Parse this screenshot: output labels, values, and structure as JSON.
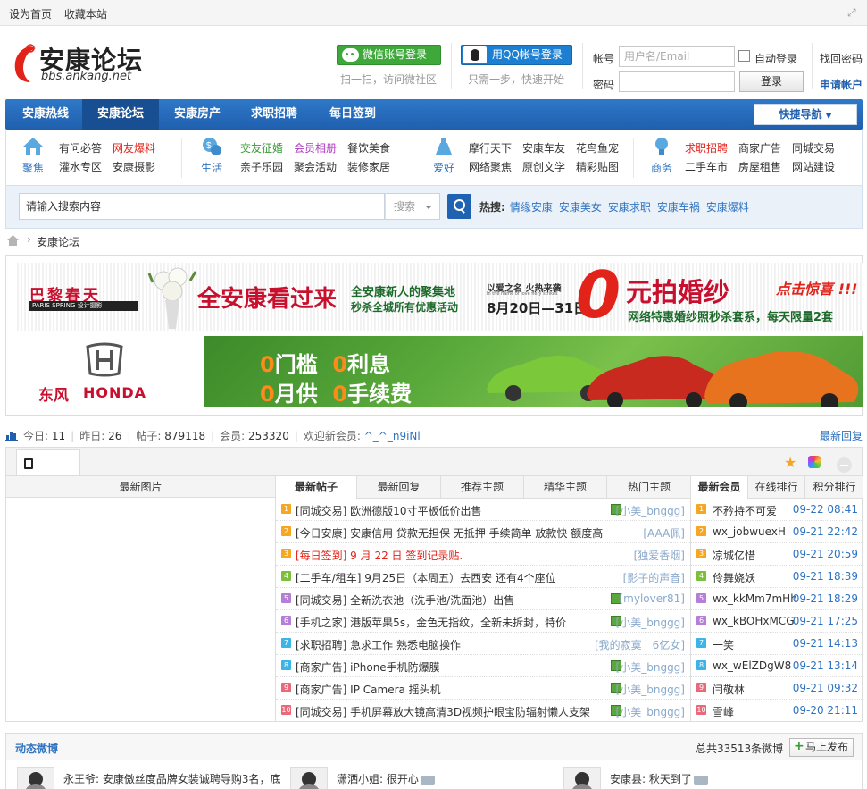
{
  "topbar": {
    "set_home": "设为首页",
    "bookmark": "收藏本站"
  },
  "logo": {
    "cn": "安康论坛",
    "url": "bbs.ankang.net"
  },
  "social": {
    "wechat_login": "微信账号登录",
    "wechat_sub": "扫一扫，访问微社区",
    "qq_login": "用QQ帐号登录",
    "qq_sub": "只需一步，快速开始"
  },
  "login": {
    "account_label": "帐号",
    "account_placeholder": "用户名/Email",
    "password_label": "密码",
    "auto_login": "自动登录",
    "login_button": "登录",
    "forgot": "找回密码",
    "register": "申请帐户"
  },
  "nav": {
    "items": [
      "安康热线",
      "安康论坛",
      "安康房产",
      "求职招聘",
      "每日签到"
    ],
    "quick": "快捷导航"
  },
  "categories": [
    {
      "name": "聚焦",
      "links": [
        "有问必答",
        "网友爆料",
        "灌水专区",
        "安康摄影"
      ]
    },
    {
      "name": "生活",
      "links": [
        "交友征婚",
        "会员相册",
        "餐饮美食",
        "亲子乐园",
        "聚会活动",
        "装修家居"
      ]
    },
    {
      "name": "爱好",
      "links": [
        "摩行天下",
        "安康车友",
        "花鸟鱼宠",
        "网络聚焦",
        "原创文学",
        "精彩贴图"
      ]
    },
    {
      "name": "商务",
      "links": [
        "求职招聘",
        "商家广告",
        "同城交易",
        "二手车市",
        "房屋租售",
        "网站建设"
      ]
    }
  ],
  "search": {
    "placeholder": "请输入搜索内容",
    "type": "搜索",
    "hot_label": "热搜:",
    "hot": [
      "情缘安康",
      "安康美女",
      "安康求职",
      "安康车祸",
      "安康爆料"
    ]
  },
  "breadcrumb": {
    "current": "安康论坛"
  },
  "banner1": {
    "brand_cn": "巴黎春天",
    "brand_en": "PARIS SPRING",
    "brand_tag": "设计摄影",
    "headline": "全安康看过来",
    "sub1": "全安康新人的聚集地",
    "sub2": "秒杀全城所有优惠活动",
    "sub3": "以爱之名 火热来袭",
    "sub4": "In the name of love fiery strikes",
    "date": "8月20日—31日",
    "zero": "0",
    "zero_text": "元拍婚纱",
    "promo": "点击惊喜 !!!",
    "detail": "网络特惠婚纱照秒杀套系，每天限量2套"
  },
  "banner2": {
    "brand_cn": "东风",
    "brand_en": "HONDA",
    "l1a": "0",
    "l1b": "门槛",
    "l1c": "0",
    "l1d": "利息",
    "l2a": "0",
    "l2b": "月供",
    "l2c": "0",
    "l2d": "手续费"
  },
  "stats": {
    "today_label": "今日:",
    "today": "11",
    "yesterday_label": "昨日:",
    "yesterday": "26",
    "posts_label": "帖子:",
    "posts": "879118",
    "members_label": "会员:",
    "members": "253320",
    "welcome": "欢迎新会员:",
    "newest": "^_^_n9iNl",
    "latest_reply": "最新回复"
  },
  "left_col": {
    "title": "最新图片"
  },
  "mid_tabs": [
    "最新帖子",
    "最新回复",
    "推荐主题",
    "精华主题",
    "热门主题"
  ],
  "threads": [
    {
      "n": "1",
      "title": "[同城交易] 欧洲德版10寸平板低价出售",
      "author": "[小美_bnggg]",
      "img": true,
      "red": false
    },
    {
      "n": "2",
      "title": "[今日安康] 安康信用 贷款无担保 无抵押 手续简单 放款快 额度高",
      "author": "[AAA佩]",
      "img": false,
      "red": false
    },
    {
      "n": "3",
      "title": "[每日签到] 9 月 22 日 签到记录贴.",
      "author": "[独爱香烟]",
      "img": false,
      "red": true
    },
    {
      "n": "4",
      "title": "[二手车/租车] 9月25日（本周五）去西安 还有4个座位",
      "author": "[影子的声音]",
      "img": false,
      "red": false
    },
    {
      "n": "5",
      "title": "[同城交易] 全新洗衣池（洗手池/洗面池）出售",
      "author": "[mylover81]",
      "img": true,
      "red": false
    },
    {
      "n": "6",
      "title": "[手机之家] 港版苹果5s，金色无指纹，全新未拆封，特价",
      "author": "[小美_bnggg]",
      "img": true,
      "red": false
    },
    {
      "n": "7",
      "title": "[求职招聘] 急求工作 熟悉电脑操作",
      "author": "[我的寂寞__6亿女]",
      "img": false,
      "red": false
    },
    {
      "n": "8",
      "title": "[商家广告] iPhone手机防爆膜",
      "author": "[小美_bnggg]",
      "img": true,
      "red": false
    },
    {
      "n": "9",
      "title": "[商家广告] IP Camera 摇头机",
      "author": "[小美_bnggg]",
      "img": true,
      "red": false
    },
    {
      "n": "10",
      "title": "[同城交易] 手机屏幕放大镜高清3D视频护眼宝防辐射懒人支架",
      "author": "[小美_bnggg]",
      "img": true,
      "red": false
    }
  ],
  "right_tabs": [
    "最新会员",
    "在线排行",
    "积分排行"
  ],
  "members": [
    {
      "n": "1",
      "name": "不矜持不可爱",
      "date": "09-22 08:41"
    },
    {
      "n": "2",
      "name": "wx_jobwuexH",
      "date": "09-21 22:42"
    },
    {
      "n": "3",
      "name": "凉城亿惜",
      "date": "09-21 20:59"
    },
    {
      "n": "4",
      "name": "伶舞娆妖",
      "date": "09-21 18:39"
    },
    {
      "n": "5",
      "name": "wx_kkMm7mHh",
      "date": "09-21 18:29"
    },
    {
      "n": "6",
      "name": "wx_kBOHxMCG",
      "date": "09-21 17:25"
    },
    {
      "n": "7",
      "name": "一笑",
      "date": "09-21 14:13"
    },
    {
      "n": "8",
      "name": "wx_wElZDgW8",
      "date": "09-21 13:14"
    },
    {
      "n": "9",
      "name": "闫敬林",
      "date": "09-21 09:32"
    },
    {
      "n": "10",
      "name": "雪峰",
      "date": "09-20 21:11"
    }
  ],
  "weibo": {
    "title": "动态微博",
    "count": "总共33513条微博",
    "publish": "马上发布",
    "items": [
      {
        "text": "永王爷: 安康傲丝度品牌女装诚聘导购3名，底"
      },
      {
        "text": "潇洒小姐: 很开心"
      },
      {
        "text": "安康县: 秋天到了"
      }
    ]
  },
  "colors": {
    "brand": "#1f5fae",
    "link": "#2f73c0",
    "red": "#e2231a"
  }
}
